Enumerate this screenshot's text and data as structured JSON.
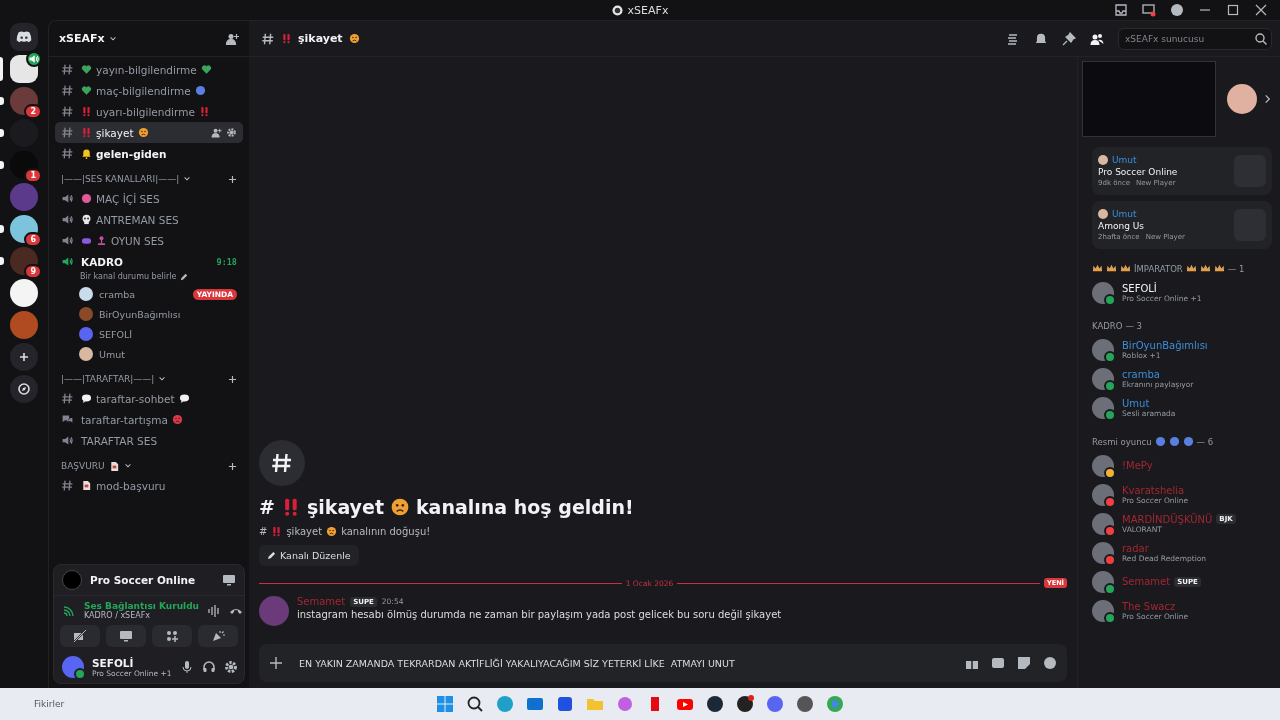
{
  "titlebar": {
    "title": "xSEAFx"
  },
  "servers": [
    {
      "kind": "home",
      "selected": false,
      "unread": false,
      "in_voice": false
    },
    {
      "kind": "server",
      "color": "#e6e6e6",
      "selected": true,
      "unread": false,
      "in_voice": true
    },
    {
      "kind": "server",
      "color": "#6b3b3b",
      "selected": false,
      "unread": true,
      "in_voice": false,
      "badge": "2"
    },
    {
      "kind": "server",
      "color": "#1b1b1f",
      "selected": false,
      "unread": true,
      "in_voice": false
    },
    {
      "kind": "server",
      "color": "#0a0a0a",
      "selected": false,
      "unread": true,
      "in_voice": false,
      "badge": "1"
    },
    {
      "kind": "server",
      "color": "#5b3a8c",
      "selected": false,
      "unread": false,
      "in_voice": false
    },
    {
      "kind": "server",
      "color": "#7cc4dc",
      "selected": false,
      "unread": true,
      "in_voice": false,
      "badge": "6"
    },
    {
      "kind": "server",
      "color": "#4a2a20",
      "selected": false,
      "unread": true,
      "in_voice": false,
      "badge": "9"
    },
    {
      "kind": "server",
      "color": "#f4f4f4",
      "selected": false,
      "unread": false,
      "in_voice": false
    },
    {
      "kind": "server",
      "color": "#b04a20",
      "selected": false,
      "unread": false,
      "in_voice": false
    },
    {
      "kind": "add",
      "selected": false,
      "unread": false,
      "in_voice": false
    },
    {
      "kind": "explore",
      "selected": false,
      "unread": false,
      "in_voice": false
    }
  ],
  "server_name": "xSEAFx",
  "channels": [
    {
      "kind": "text",
      "name": "yayın-bilgilendirme",
      "lead": [
        {
          "kind": "heart"
        }
      ],
      "trail": [
        {
          "kind": "heart"
        }
      ],
      "selected": false,
      "unread": false
    },
    {
      "kind": "text",
      "name": "maç-bilgilendirme",
      "lead": [
        {
          "kind": "heart"
        }
      ],
      "trail": [
        {
          "kind": "ball"
        }
      ],
      "selected": false,
      "unread": false
    },
    {
      "kind": "text",
      "name": "uyarı-bilgilendirme",
      "lead": [
        {
          "kind": "exclamation"
        }
      ],
      "trail": [
        {
          "kind": "exclamation"
        }
      ],
      "selected": false,
      "unread": false
    },
    {
      "kind": "text",
      "name": "şikayet",
      "lead": [
        {
          "kind": "exclamation"
        }
      ],
      "trail": [
        {
          "kind": "face"
        }
      ],
      "selected": true,
      "unread": false
    },
    {
      "kind": "text",
      "name": "gelen-giden",
      "lead": [
        {
          "kind": "bell"
        }
      ],
      "selected": false,
      "unread": true
    },
    {
      "kind": "category",
      "name": "|——|SES KANALLARI|——|",
      "children": [
        {
          "kind": "voice",
          "name": "MAÇ İÇİ SES",
          "lead": [
            {
              "kind": "brain"
            }
          ],
          "selected": false,
          "unread": false
        },
        {
          "kind": "voice",
          "name": "ANTREMAN SES",
          "lead": [
            {
              "kind": "skull"
            }
          ],
          "selected": false,
          "unread": false
        },
        {
          "kind": "voice",
          "name": "OYUN SES",
          "lead": [
            {
              "kind": "gamepad"
            },
            {
              "kind": "joystick"
            }
          ],
          "selected": false,
          "unread": false
        },
        {
          "kind": "voice",
          "name": "KADRO",
          "selected": false,
          "unread": true,
          "connected": true,
          "timer": "9:18",
          "status": "Bir kanal durumu belirle",
          "members": [
            {
              "name": "cramba",
              "color": "#c8dcec",
              "live": "YAYINDA"
            },
            {
              "name": "BirOyunBağımlısı",
              "color": "#8a4a2a"
            },
            {
              "name": "SEFOLİ",
              "color": "#5865f2"
            },
            {
              "name": "Umut",
              "color": "#d8b8a0"
            }
          ]
        }
      ]
    },
    {
      "kind": "category",
      "name": "|——|TARAFTAR|——|",
      "children": [
        {
          "kind": "text",
          "name": "taraftar-sohbet",
          "lead": [
            {
              "kind": "bubble"
            }
          ],
          "trail": [
            {
              "kind": "bubble"
            }
          ],
          "selected": false,
          "unread": false
        },
        {
          "kind": "forum",
          "name": "taraftar-tartışma",
          "trail": [
            {
              "kind": "angry"
            }
          ],
          "selected": false,
          "unread": false
        },
        {
          "kind": "voice",
          "name": "TARAFTAR SES",
          "selected": false,
          "unread": false
        }
      ]
    },
    {
      "kind": "category",
      "name": "BAŞVURU",
      "trail": [
        {
          "kind": "document"
        }
      ],
      "children": [
        {
          "kind": "text",
          "name": "mod-başvuru",
          "lead": [
            {
              "kind": "document"
            }
          ],
          "selected": false,
          "unread": false
        }
      ]
    }
  ],
  "activity_panel": {
    "game": "Pro Soccer Online"
  },
  "voice_panel": {
    "status": "Ses Bağlantısı Kuruldu",
    "location": "KADRO / xSEAFx"
  },
  "user_panel": {
    "name": "SEFOLİ",
    "activity": "Pro Soccer Online +1"
  },
  "header": {
    "channel": "şikayet",
    "lead": [
      {
        "kind": "exclamation"
      }
    ],
    "trail": [
      {
        "kind": "face"
      }
    ],
    "search": {
      "placeholder": "xSEAFx sunucusu"
    }
  },
  "welcome": {
    "prefix": "#",
    "channel": "şikayet",
    "suffix": "kanalına hoş geldin!",
    "sub_prefix": "#",
    "sub_channel": "şikayet",
    "sub_suffix": "kanalının doğuşu!",
    "button": "Kanalı Düzenle"
  },
  "divider": {
    "date": "1 Ocak 2026",
    "badge": "YENİ"
  },
  "messages": [
    {
      "author": "Semamet",
      "color": "#a32630",
      "badge": "SUPE",
      "time": "20:54",
      "text": "instagram hesabı ölmüş durumda ne zaman bir paylaşım yada post gelicek bu soru değil şikayet"
    }
  ],
  "composer": {
    "value": "EN YAKIN ZAMANDA TEKRARDAN AKTİFLİĞİ YAKALIYACAĞIM SİZ YETERKİ LİKE  ATMAYI UNUT"
  },
  "activity_cards": [
    {
      "user": "Umut",
      "game": "Pro Soccer Online",
      "time": "9dk önce",
      "tag": "New Player"
    },
    {
      "user": "Umut",
      "game": "Among Us",
      "time": "2hafta önce",
      "tag": "New Player"
    }
  ],
  "member_groups": [
    {
      "title": "İMPARATOR",
      "count": "— 1",
      "color": "#f2f3f5",
      "lead": [
        {
          "kind": "crown"
        },
        {
          "kind": "crown"
        },
        {
          "kind": "crown"
        }
      ],
      "trail": [
        {
          "kind": "crown"
        },
        {
          "kind": "crown"
        },
        {
          "kind": "crown"
        }
      ],
      "members": [
        {
          "name": "SEFOLİ",
          "color": "#23a55a",
          "activity": "Pro Soccer Online +1"
        }
      ]
    },
    {
      "title": "KADRO",
      "count": "— 3",
      "color": "#3b8ed8",
      "members": [
        {
          "name": "BirOyunBağımlısı",
          "color": "#23a55a",
          "activity": "Roblox +1"
        },
        {
          "name": "cramba",
          "color": "#23a55a",
          "activity": "Ekranını paylaşıyor"
        },
        {
          "name": "Umut",
          "color": "#23a55a",
          "activity": "Sesli aramada"
        }
      ]
    },
    {
      "title": "Resmi oyuncu",
      "count": "— 6",
      "color": "#a32630",
      "trail": [
        {
          "kind": "ball"
        },
        {
          "kind": "ball"
        },
        {
          "kind": "ball"
        }
      ],
      "members": [
        {
          "name": "!MePy",
          "color": "#f0b232"
        },
        {
          "name": "Kvaratshelia",
          "color": "#f23f43",
          "activity": "Pro Soccer Online"
        },
        {
          "name": "MARDİNDÜŞKÜNÜ",
          "color": "#f23f43",
          "badge": "BJK",
          "activity": "VALORANT"
        },
        {
          "name": "radar",
          "color": "#f23f43",
          "activity": "Red Dead Redemption"
        },
        {
          "name": "Semamet",
          "color": "#23a55a",
          "badge": "SUPE"
        },
        {
          "name": "The Swacz",
          "color": "#23a55a",
          "activity": "Pro Soccer Online"
        }
      ]
    }
  ],
  "taskbar": {
    "widget": "Fikirler"
  }
}
